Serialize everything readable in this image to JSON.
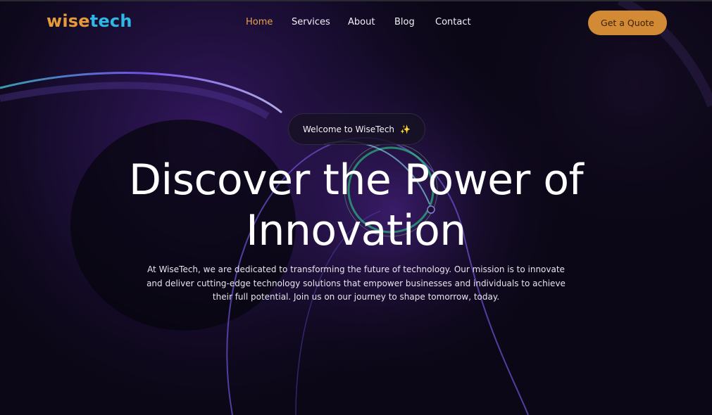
{
  "brand": {
    "part1": "wise",
    "part2": "tech"
  },
  "nav": {
    "items": [
      {
        "label": "Home",
        "active": true
      },
      {
        "label": "Services",
        "active": false
      },
      {
        "label": "About",
        "active": false
      },
      {
        "label": "Blog",
        "active": false
      },
      {
        "label": "Contact",
        "active": false
      }
    ]
  },
  "cta": {
    "label": "Get a Quote"
  },
  "hero": {
    "badge": "Welcome to WiseTech",
    "badge_icon": "sparkle-icon",
    "headline_line1": "Discover the Power of",
    "headline_line2": "Innovation",
    "description": "At WiseTech, we are dedicated to transforming the future of technology. Our mission is to innovate and deliver cutting-edge technology solutions that empower businesses and individuals to achieve their full potential. Join us on our journey to shape tomorrow, today."
  },
  "colors": {
    "background": "#0b0716",
    "accent_orange": "#e59a3b",
    "accent_blue": "#2fb7e6",
    "cta_bg": "#d28a35"
  }
}
